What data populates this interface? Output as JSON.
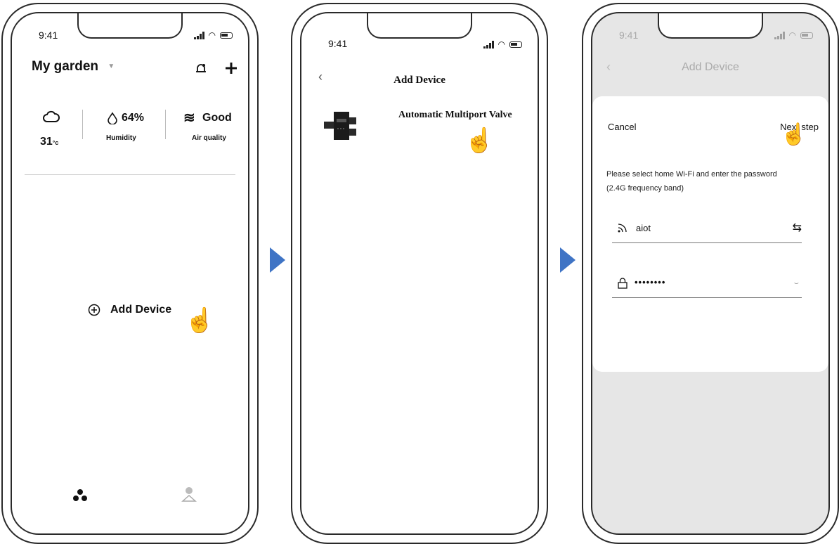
{
  "status_time": "9:41",
  "screen1": {
    "title": "My garden",
    "temperature": "31",
    "temperature_unit": "°c",
    "humidity_value": "64%",
    "humidity_label": "Humidity",
    "air_value": "Good",
    "air_label": "Air quality",
    "add_device_label": "Add Device"
  },
  "screen2": {
    "title": "Add Device",
    "device_name": "Automatic Multiport Valve",
    "device_screen_text": "8888"
  },
  "screen3": {
    "title": "Add Device",
    "cancel_label": "Cancel",
    "next_label": "Next step",
    "instruction": "Please select home Wi-Fi and enter the password (2.4G frequency band)",
    "wifi_name": "aiot",
    "password_masked": "••••••••"
  },
  "colors": {
    "arrow": "#3f74c5",
    "outline": "#2a2a2a",
    "dim_overlay": "#e6e6e6"
  }
}
